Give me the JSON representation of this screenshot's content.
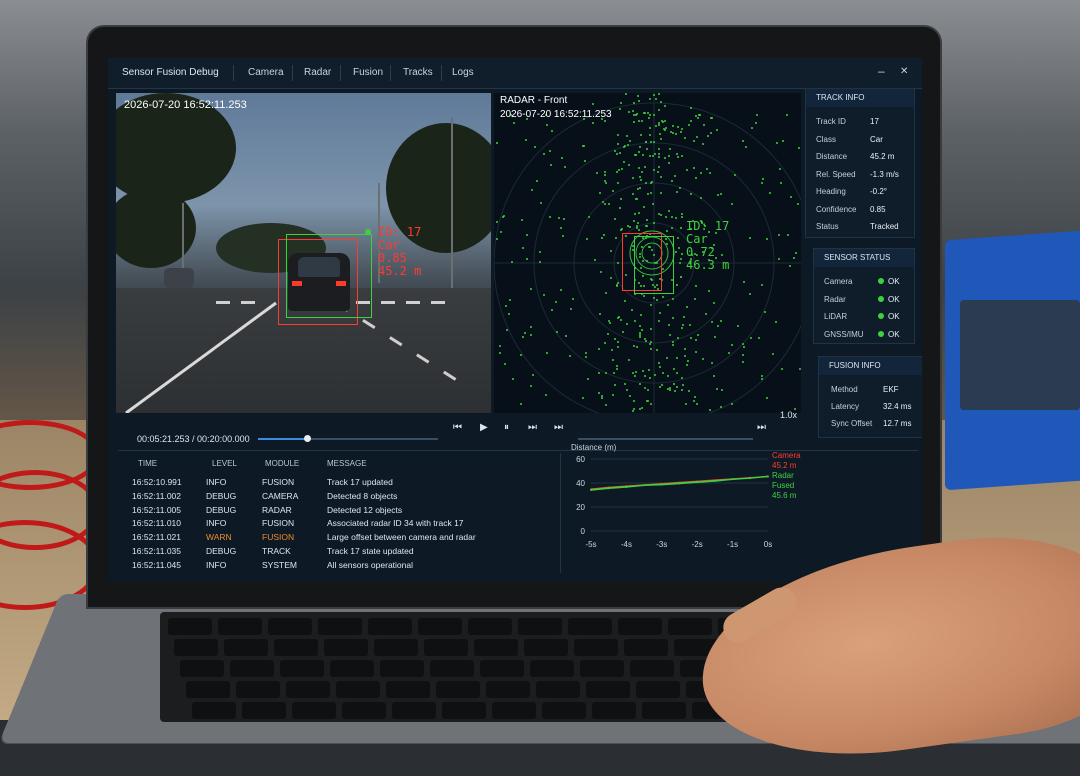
{
  "app": {
    "title": "Sensor Fusion Debug"
  },
  "tabs": [
    "Camera",
    "Radar",
    "Fusion",
    "Tracks",
    "Logs"
  ],
  "window_controls": {
    "minimize": "–",
    "close": "✕"
  },
  "camera": {
    "timestamp": "2026-07-20  16:52:11.253",
    "detection": {
      "id": "ID: 17",
      "class": "Car",
      "conf": "0.85",
      "dist": "45.2 m"
    },
    "colors": {
      "camera_box": "#ff3b30",
      "radar_box": "#3ed13e"
    }
  },
  "radar": {
    "title": "RADAR - Front",
    "timestamp": "2026-07-20  16:52:11.253",
    "detection": {
      "id": "ID: 17",
      "class": "Car",
      "conf": "0.72",
      "dist": "46.3 m"
    }
  },
  "transport": {
    "time": "00:05:21.253 / 00:20:00.000",
    "speed": "1.0x",
    "progress": 0.27,
    "icons": [
      "skip-back-icon",
      "play-icon",
      "pause-icon",
      "fast-forward-icon",
      "skip-end-icon"
    ]
  },
  "track_info": {
    "header": "TRACK INFO",
    "rows": [
      {
        "k": "Track ID",
        "v": "17"
      },
      {
        "k": "Class",
        "v": "Car"
      },
      {
        "k": "Distance",
        "v": "45.2 m"
      },
      {
        "k": "Rel. Speed",
        "v": "-1.3 m/s"
      },
      {
        "k": "Heading",
        "v": "-0.2°"
      },
      {
        "k": "Confidence",
        "v": "0.85"
      },
      {
        "k": "Status",
        "v": "Tracked"
      }
    ]
  },
  "sensor_status": {
    "header": "SENSOR STATUS",
    "rows": [
      {
        "k": "Camera",
        "v": "OK"
      },
      {
        "k": "Radar",
        "v": "OK"
      },
      {
        "k": "LiDAR",
        "v": "OK"
      },
      {
        "k": "GNSS/IMU",
        "v": "OK"
      }
    ]
  },
  "fusion_info": {
    "header": "FUSION INFO",
    "rows": [
      {
        "k": "Method",
        "v": "EKF"
      },
      {
        "k": "Latency",
        "v": "32.4 ms"
      },
      {
        "k": "Sync Offset",
        "v": "12.7 ms"
      }
    ]
  },
  "log": {
    "headers": [
      "TIME",
      "LEVEL",
      "MODULE",
      "MESSAGE"
    ],
    "rows": [
      {
        "time": "16:52:10.991",
        "level": "INFO",
        "module": "FUSION",
        "message": "Track 17 updated",
        "warn": false
      },
      {
        "time": "16:52:11.002",
        "level": "DEBUG",
        "module": "CAMERA",
        "message": "Detected 8 objects",
        "warn": false
      },
      {
        "time": "16:52:11.005",
        "level": "DEBUG",
        "module": "RADAR",
        "message": "Detected 12 objects",
        "warn": false
      },
      {
        "time": "16:52:11.010",
        "level": "INFO",
        "module": "FUSION",
        "message": "Associated radar ID 34 with track 17",
        "warn": false
      },
      {
        "time": "16:52:11.021",
        "level": "WARN",
        "module": "FUSION",
        "message": "Large offset between camera and radar",
        "warn": true
      },
      {
        "time": "16:52:11.035",
        "level": "DEBUG",
        "module": "TRACK",
        "message": "Track 17 state updated",
        "warn": false
      },
      {
        "time": "16:52:11.045",
        "level": "INFO",
        "module": "SYSTEM",
        "message": "All sensors operational",
        "warn": false
      }
    ]
  },
  "chart_data": {
    "type": "line",
    "title": "Distance (m)",
    "xlabel": "",
    "ylabel": "",
    "x": [
      -5,
      -4.5,
      -4,
      -3.5,
      -3,
      -2.5,
      -2,
      -1.5,
      -1,
      -0.5,
      0
    ],
    "x_ticks": [
      "-5s",
      "-4s",
      "-3s",
      "-2s",
      "-1s",
      "0s"
    ],
    "y_ticks": [
      "60",
      "40",
      "20",
      "0"
    ],
    "ylim": [
      0,
      60
    ],
    "grid": true,
    "series": [
      {
        "name": "Camera",
        "label_value": "45.2 m",
        "color": "#ff3b30",
        "values": [
          35,
          36.5,
          37.5,
          38.5,
          39.5,
          40.5,
          41.5,
          42.5,
          43.5,
          44.5,
          45.2
        ]
      },
      {
        "name": "Radar",
        "label_value": "",
        "color": "#3ed13e",
        "values": [
          34,
          35.5,
          36.5,
          38,
          38.5,
          39.5,
          40.5,
          41.5,
          43,
          44,
          45.5
        ]
      },
      {
        "name": "Fused",
        "label_value": "45.6 m",
        "color": "#3ed13e",
        "values": [
          34.5,
          36,
          37,
          38.2,
          39,
          40,
          41,
          42,
          43.2,
          44.2,
          45.6
        ]
      }
    ]
  }
}
